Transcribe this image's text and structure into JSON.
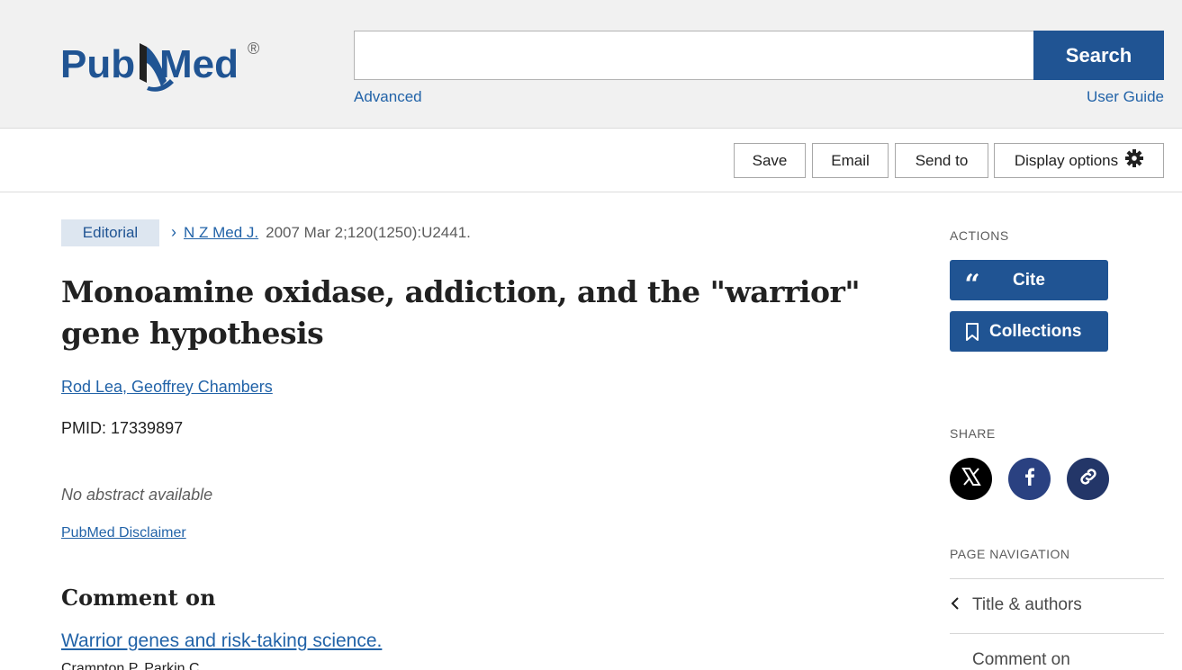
{
  "header": {
    "logo_text": "PubMed",
    "logo_registered": "®",
    "search_placeholder": "",
    "search_value": "",
    "search_button": "Search",
    "advanced_link": "Advanced",
    "user_guide_link": "User Guide"
  },
  "toolbar": {
    "save": "Save",
    "email": "Email",
    "send_to": "Send to",
    "display_options": "Display options"
  },
  "article": {
    "type_badge": "Editorial",
    "journal": "N Z Med J.",
    "citation": "2007 Mar 2;120(1250):U2441.",
    "title": "Monoamine oxidase, addiction, and the \"warrior\" gene hypothesis",
    "authors": "Rod Lea, Geoffrey Chambers",
    "pmid_label": "PMID: ",
    "pmid": "17339897",
    "no_abstract": "No abstract available",
    "disclaimer": "PubMed Disclaimer",
    "comment_heading": "Comment on",
    "comment_link": "Warrior genes and risk-taking science.",
    "comment_authors": "Crampton P, Parkin C."
  },
  "sidebar": {
    "actions_label": "ACTIONS",
    "cite_button": "Cite",
    "collections_button": "Collections",
    "share_label": "SHARE",
    "page_navigation_label": "PAGE NAVIGATION",
    "nav_items": [
      "Title & authors",
      "Comment on"
    ]
  },
  "colors": {
    "primary": "#205493",
    "link": "#2263a8",
    "header_bg": "#f1f1f1",
    "badge_bg": "#dde6f0"
  },
  "icons": {
    "settings": "gear-icon",
    "cite": "quote-icon",
    "collections": "bookmark-icon",
    "share_x": "x-logo-icon",
    "share_facebook": "facebook-icon",
    "share_link": "link-icon",
    "nav": "chevron-left-icon"
  }
}
